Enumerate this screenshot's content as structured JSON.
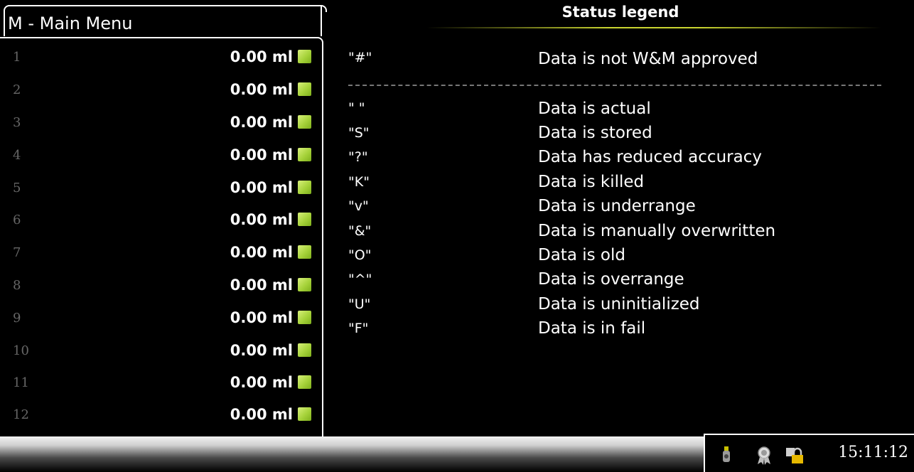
{
  "menu": {
    "title": "M - Main Menu"
  },
  "channels": [
    {
      "number": "1",
      "value": "0.00 ml"
    },
    {
      "number": "2",
      "value": "0.00 ml"
    },
    {
      "number": "3",
      "value": "0.00 ml"
    },
    {
      "number": "4",
      "value": "0.00 ml"
    },
    {
      "number": "5",
      "value": "0.00 ml"
    },
    {
      "number": "6",
      "value": "0.00 ml"
    },
    {
      "number": "7",
      "value": "0.00 ml"
    },
    {
      "number": "8",
      "value": "0.00 ml"
    },
    {
      "number": "9",
      "value": "0.00 ml"
    },
    {
      "number": "10",
      "value": "0.00 ml"
    },
    {
      "number": "11",
      "value": "0.00 ml"
    },
    {
      "number": "12",
      "value": "0.00 ml"
    }
  ],
  "legend": {
    "title": "Status legend",
    "header_item": {
      "code": "\"#\"",
      "description": "Data is not W&M approved"
    },
    "items": [
      {
        "code": "\" \"",
        "description": "Data is actual"
      },
      {
        "code": "\"S\"",
        "description": "Data is stored"
      },
      {
        "code": "\"?\"",
        "description": "Data has reduced accuracy"
      },
      {
        "code": "\"K\"",
        "description": "Data is killed"
      },
      {
        "code": "\"v\"",
        "description": "Data is underrange"
      },
      {
        "code": "\"&\"",
        "description": "Data is manually overwritten"
      },
      {
        "code": "\"O\"",
        "description": "Data is old"
      },
      {
        "code": "\"^\"",
        "description": "Data is overrange"
      },
      {
        "code": "\"U\"",
        "description": "Data is uninitialized"
      },
      {
        "code": "\"F\"",
        "description": "Data is in fail"
      }
    ]
  },
  "tray": {
    "icons": [
      "usb-device-icon",
      "award-ribbon-icon",
      "lock-user-icon"
    ],
    "clock": "15:11:12"
  },
  "colors": {
    "status_led": "#a6d23a",
    "title_underline": "#c9d430"
  }
}
